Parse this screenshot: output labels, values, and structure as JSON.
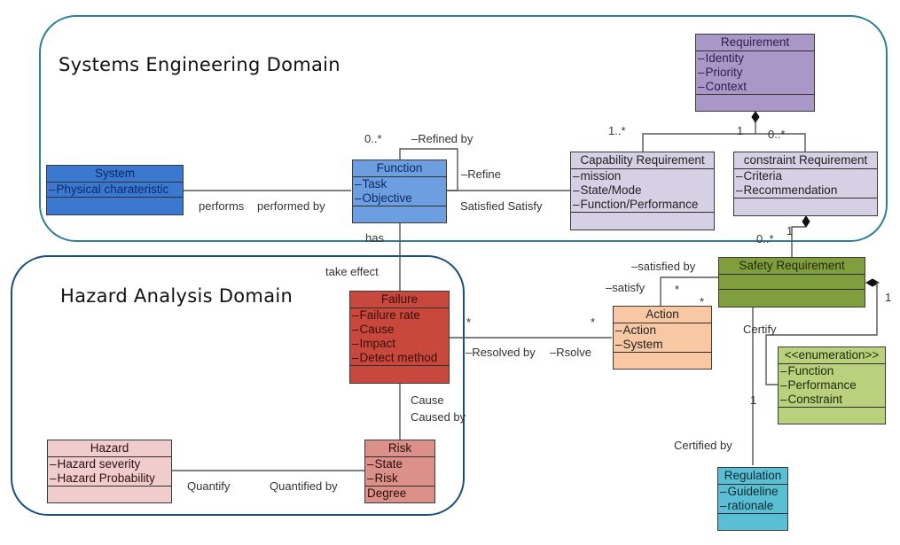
{
  "domains": {
    "systems_engineering": {
      "title": "Systems Engineering  Domain",
      "border_color": "#2f7f98"
    },
    "hazard_analysis": {
      "title": "Hazard Analysis  Domain",
      "border_color": "#1e4e7e"
    }
  },
  "classes": {
    "system": {
      "name": "System",
      "attributes": [
        "Physical charateristic"
      ],
      "fill": "#3b78d0",
      "text_color": "#0d2a66"
    },
    "function": {
      "name": "Function",
      "attributes": [
        "Task",
        "Objective"
      ],
      "fill": "#6d9ee0",
      "text_color": "#0d2a66"
    },
    "requirement": {
      "name": "Requirement",
      "attributes": [
        "Identity",
        "Priority",
        "Context"
      ],
      "fill": "#a997c8",
      "text_color": "#2a1f4d"
    },
    "capability_requirement": {
      "name": "Capability Requirement",
      "attributes": [
        "mission",
        "State/Mode",
        "Function/Performance"
      ],
      "fill": "#d6d0e4",
      "text_color": "#222"
    },
    "constraint_requirement": {
      "name": "constraint Requirement",
      "attributes": [
        "Criteria",
        "Recommendation"
      ],
      "fill": "#d6d0e4",
      "text_color": "#222"
    },
    "safety_requirement": {
      "name": "Safety Requirement",
      "attributes": [],
      "fill": "#7f9e3d",
      "text_color": "#1f2a0a"
    },
    "action": {
      "name": "Action",
      "attributes": [
        "Action",
        "System"
      ],
      "fill": "#f8c8a4",
      "text_color": "#222"
    },
    "enumeration": {
      "name": "<<enumeration>>",
      "attributes": [
        "Function",
        "Performance",
        "Constraint"
      ],
      "fill": "#b9d17c",
      "text_color": "#1f2a0a"
    },
    "failure": {
      "name": "Failure",
      "attributes": [
        "Failure rate",
        "Cause",
        "Impact",
        "Detect method"
      ],
      "fill": "#c8483e",
      "text_color": "#3a0d0a"
    },
    "risk": {
      "name": "Risk",
      "attributes": [
        "State",
        "Risk"
      ],
      "operations": [
        "Degree"
      ],
      "fill": "#dc908a",
      "text_color": "#2a0d0a"
    },
    "hazard": {
      "name": "Hazard",
      "attributes": [
        "Hazard severity",
        "Hazard Probability"
      ],
      "fill": "#f0cccc",
      "text_color": "#2a1010"
    },
    "regulation": {
      "name": "Regulation",
      "attributes": [
        "Guideline",
        "rationale"
      ],
      "fill": "#5bbfd4",
      "text_color": "#0a2a33"
    }
  },
  "labels": {
    "performs": "performs",
    "performed_by": "performed by",
    "refined_by": "–Refined by",
    "refine": "–Refine",
    "refine_mult": "0..*",
    "satisfied_satisfy": "Satisfied Satisfy",
    "has": "has",
    "take_effect": "take effect",
    "req_mult_cap": "1..*",
    "req_mult_one": "1",
    "req_mult_con": "0..*",
    "con_mult_one": "1",
    "con_mult_many": "0..*",
    "satisfied_by": "–satisfied by",
    "satisfy": "–satisfy",
    "star_a": "*",
    "star_b": "*",
    "star_failure": "*",
    "star_action": "*",
    "resolved_by": "–Resolved by",
    "rsolve": "–Rsolve",
    "cause": "Cause",
    "caused_by": "Caused by",
    "quantify": "Quantify",
    "quantified_by": "Quantified by",
    "certify": "Certify",
    "certified_by": "Certified by",
    "cert_mult": "1",
    "enum_mult": "1"
  }
}
